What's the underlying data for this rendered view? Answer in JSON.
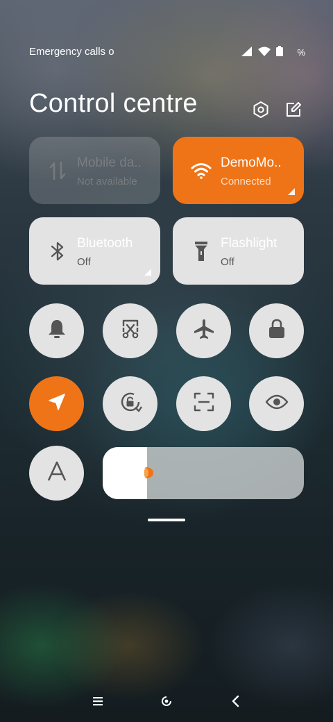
{
  "status_bar": {
    "emergency_text": "Emergency calls o",
    "battery_percent": "%"
  },
  "header": {
    "title": "Control centre",
    "settings_icon": "hexagon-settings-icon",
    "edit_icon": "edit-icon"
  },
  "tiles": {
    "mobile_data": {
      "label": "Mobile da..",
      "sub": "Not available",
      "icon": "data-arrows-icon",
      "active": false
    },
    "wifi": {
      "label": "DemoMo..",
      "sub": "Connected",
      "icon": "wifi-icon",
      "active": true
    },
    "bluetooth": {
      "label": "Bluetooth",
      "sub": "Off",
      "icon": "bluetooth-icon",
      "active": false
    },
    "flashlight": {
      "label": "Flashlight",
      "sub": "Off",
      "icon": "flashlight-icon",
      "active": false
    }
  },
  "toggles": [
    {
      "name": "bell",
      "icon": "bell-icon",
      "active": false
    },
    {
      "name": "screenshot",
      "icon": "screenshot-icon",
      "active": false
    },
    {
      "name": "airplane",
      "icon": "airplane-icon",
      "active": false
    },
    {
      "name": "lock",
      "icon": "lock-icon",
      "active": false
    },
    {
      "name": "location",
      "icon": "location-icon",
      "active": true
    },
    {
      "name": "rotation-lock",
      "icon": "rotation-lock-icon",
      "active": false
    },
    {
      "name": "scanner",
      "icon": "scanner-icon",
      "active": false
    },
    {
      "name": "reading-mode",
      "icon": "eye-icon",
      "active": false
    },
    {
      "name": "auto-brightness",
      "icon": "font-a-icon",
      "active": false
    }
  ],
  "brightness": {
    "level": 0.22
  },
  "colors": {
    "accent": "#ef7417",
    "tile_bg": "#e3e3e3",
    "icon": "#555555"
  },
  "nav": {
    "buttons": [
      "menu-icon",
      "home-icon",
      "back-icon"
    ]
  }
}
